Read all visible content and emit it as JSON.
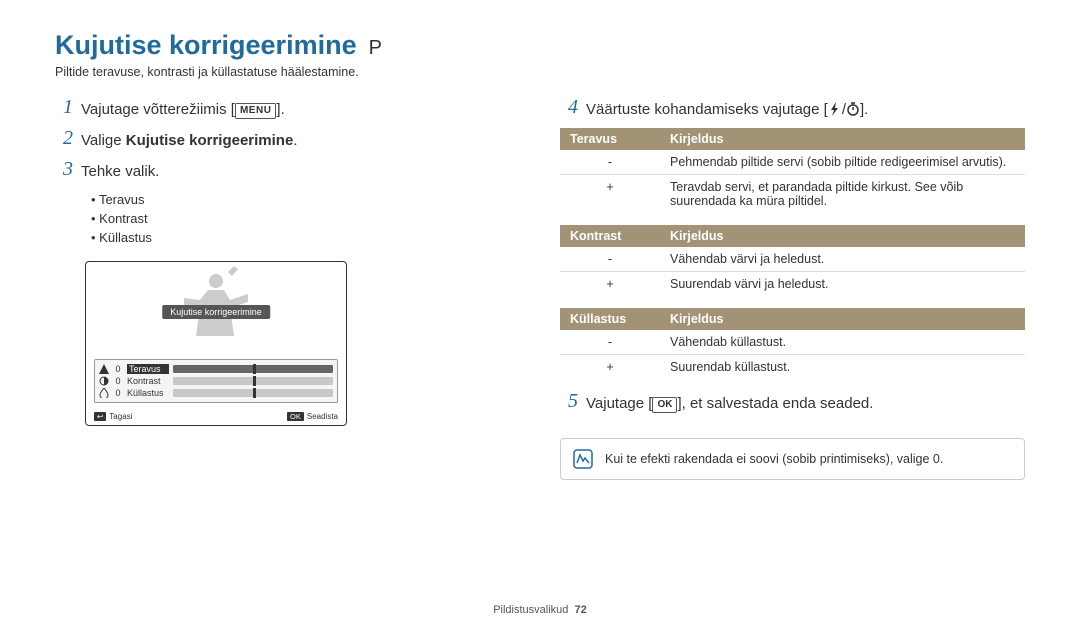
{
  "header": {
    "title": "Kujutise korrigeerimine",
    "mode": "P",
    "subtitle": "Piltide teravuse, kontrasti ja küllastatuse häälestamine."
  },
  "left": {
    "step1_num": "1",
    "step1_pre": "Vajutage võtterežiimis [",
    "step1_menu": "MENU",
    "step1_post": "].",
    "step2_num": "2",
    "step2_pre": "Valige ",
    "step2_bold": "Kujutise korrigeerimine",
    "step2_post": ".",
    "step3_num": "3",
    "step3_text": "Tehke valik.",
    "bullets": [
      "Teravus",
      "Kontrast",
      "Küllastus"
    ],
    "lcd": {
      "title": "Kujutise korrigeerimine",
      "rows": [
        {
          "val": "0",
          "label": "Teravus"
        },
        {
          "val": "0",
          "label": "Kontrast"
        },
        {
          "val": "0",
          "label": "Küllastus"
        }
      ],
      "back_btn": "↩",
      "back": "Tagasi",
      "ok_btn": "OK",
      "set": "Seadista"
    }
  },
  "right": {
    "step4_num": "4",
    "step4_pre": "Väärtuste kohandamiseks vajutage [",
    "step4_sep": "/",
    "step4_post": "].",
    "tables": [
      {
        "h1": "Teravus",
        "h2": "Kirjeldus",
        "rows": [
          {
            "k": "-",
            "v": "Pehmendab piltide servi (sobib piltide redigeerimisel arvutis)."
          },
          {
            "k": "+",
            "v": "Teravdab servi, et parandada piltide kirkust. See võib suurendada ka müra piltidel."
          }
        ]
      },
      {
        "h1": "Kontrast",
        "h2": "Kirjeldus",
        "rows": [
          {
            "k": "-",
            "v": "Vähendab värvi ja heledust."
          },
          {
            "k": "+",
            "v": "Suurendab värvi ja heledust."
          }
        ]
      },
      {
        "h1": "Küllastus",
        "h2": "Kirjeldus",
        "rows": [
          {
            "k": "-",
            "v": "Vähendab küllastust."
          },
          {
            "k": "+",
            "v": "Suurendab küllastust."
          }
        ]
      }
    ],
    "step5_num": "5",
    "step5_pre": "Vajutage [",
    "step5_ok": "OK",
    "step5_post": "], et salvestada enda seaded.",
    "note": "Kui te efekti rakendada ei soovi (sobib printimiseks), valige 0."
  },
  "footer": {
    "section": "Pildistusvalikud",
    "page": "72"
  }
}
